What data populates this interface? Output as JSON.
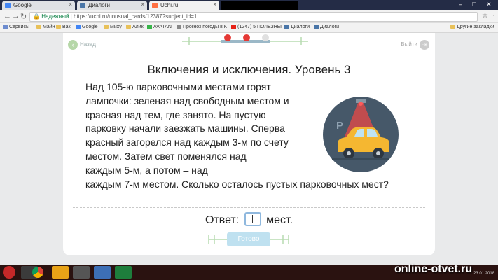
{
  "browser": {
    "tabs": [
      {
        "label": "Google",
        "active": false
      },
      {
        "label": "Диалоги",
        "active": false
      },
      {
        "label": "Uchi.ru",
        "active": true
      }
    ],
    "secure_label": "Надежный",
    "url": "https://uchi.ru/unusual_cards/12387?subject_id=1",
    "bookmarks": [
      "Сервисы",
      "Майн",
      "Вак",
      "Google",
      "Миху",
      "Алик",
      "AVATAN",
      "Прогноз погоды в К",
      "(1247) 5 ПОЛЕЗНЫ",
      "Диалоги",
      "Диалоги"
    ],
    "other_bookmarks": "Другие закладки"
  },
  "card": {
    "back_label": "Назад",
    "exit_label": "Выйти",
    "title": "Включения и исключения. Уровень 3",
    "problem_lines": [
      "Над 105-ю парковочными местами горят",
      "лампочки: зеленая над свободным местом и",
      "красная над тем, где занято. На пустую",
      "парковку начали заезжать машины. Сперва",
      "красный загорелся над каждым 3-м по счету",
      "местом. Затем свет поменялся над",
      "каждым 5-м, а потом – над",
      "каждым 7-м местом. Сколько осталось пустых парковочных мест?"
    ],
    "parking_sign": "P",
    "answer_label": "Ответ:",
    "answer_value": "",
    "answer_unit": "мест.",
    "ready_button": "Готово"
  },
  "taskbar": {
    "watermark": "online-otvet.ru",
    "date": "23.01.2018"
  },
  "colors": {
    "accent_green": "#b6d7a8",
    "button_blue": "#bfe1f0",
    "car_yellow": "#f5b731",
    "lamp_red": "#e53935"
  }
}
